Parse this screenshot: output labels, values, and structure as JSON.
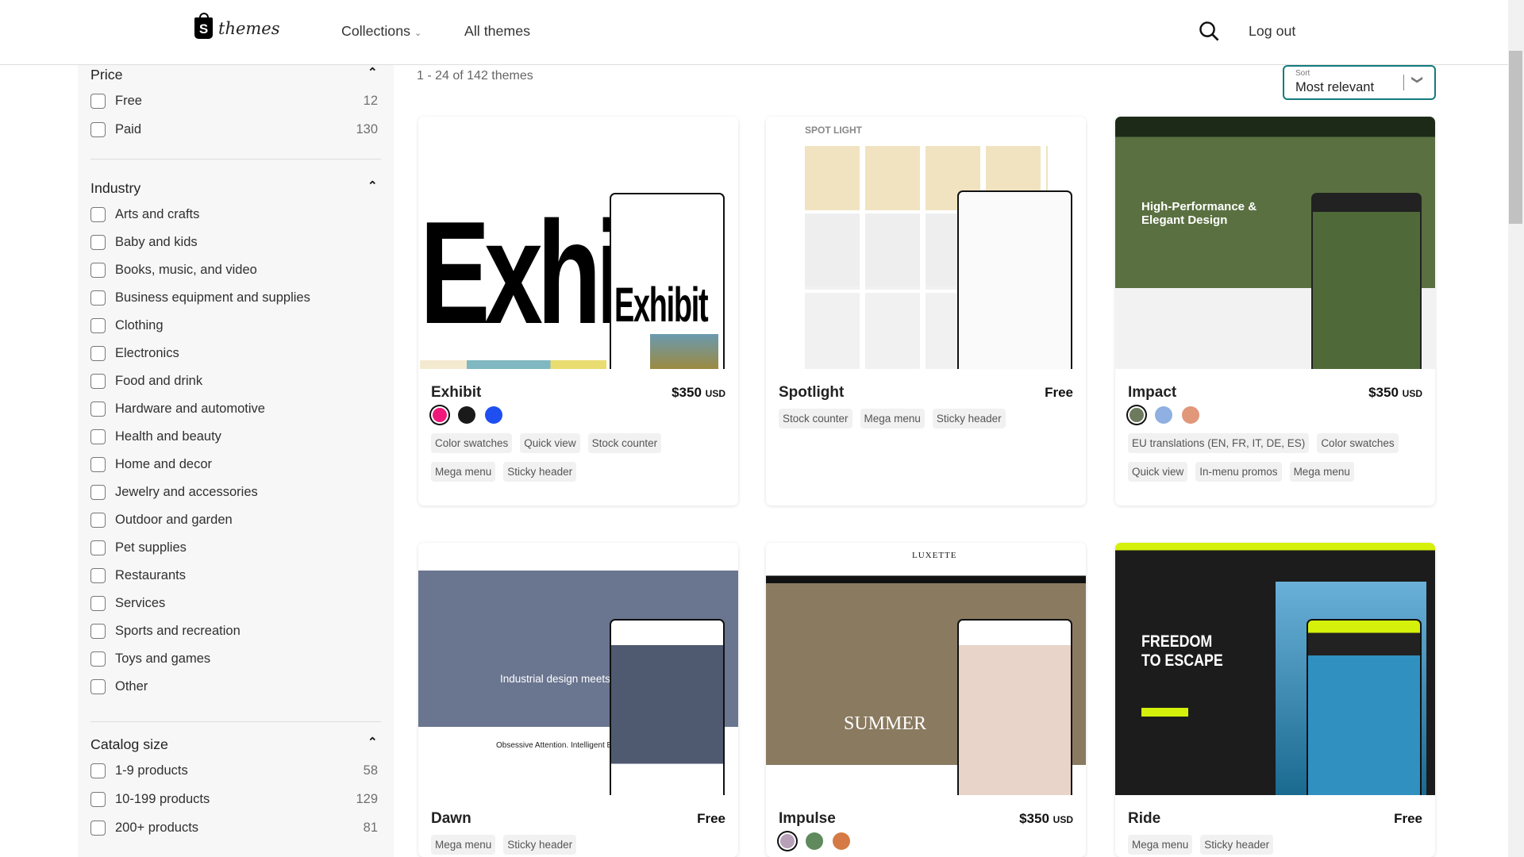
{
  "header": {
    "logo_text": "themes",
    "nav": [
      {
        "label": "Collections"
      },
      {
        "label": "All themes"
      }
    ],
    "logout": "Log out"
  },
  "sidebar": {
    "price": {
      "title": "Price",
      "options": [
        {
          "label": "Free",
          "count": "12"
        },
        {
          "label": "Paid",
          "count": "130"
        }
      ]
    },
    "industry": {
      "title": "Industry",
      "options": [
        "Arts and crafts",
        "Baby and kids",
        "Books, music, and video",
        "Business equipment and supplies",
        "Clothing",
        "Electronics",
        "Food and drink",
        "Hardware and automotive",
        "Health and beauty",
        "Home and decor",
        "Jewelry and accessories",
        "Outdoor and garden",
        "Pet supplies",
        "Restaurants",
        "Services",
        "Sports and recreation",
        "Toys and games",
        "Other"
      ]
    },
    "catalog": {
      "title": "Catalog size",
      "options": [
        {
          "label": "1-9 products",
          "count": "58"
        },
        {
          "label": "10-199 products",
          "count": "129"
        },
        {
          "label": "200+ products",
          "count": "81"
        }
      ]
    }
  },
  "results": {
    "count": "1 - 24 of 142 themes",
    "sort_label": "Sort",
    "sort_value": "Most relevant"
  },
  "themes": [
    {
      "name": "Exhibit",
      "price": "$350",
      "currency": "USD",
      "swatches": [
        "#f0187a",
        "#1a1a1a",
        "#1f4ff0"
      ],
      "tags": [
        "Color swatches",
        "Quick view",
        "Stock counter",
        "Mega menu",
        "Sticky header"
      ],
      "preview": {
        "headline": "Exhi",
        "phone_headline": "Exhibit"
      }
    },
    {
      "name": "Spotlight",
      "price": "Free",
      "currency": "",
      "swatches": [],
      "tags": [
        "Stock counter",
        "Mega menu",
        "Sticky header"
      ],
      "preview": {
        "headline": "SPOT LIGHT"
      }
    },
    {
      "name": "Impact",
      "price": "$350",
      "currency": "USD",
      "swatches": [
        "#6e7a5e",
        "#8fb0e0",
        "#e0977a"
      ],
      "tags": [
        "EU translations (EN, FR, IT, DE, ES)",
        "Color swatches",
        "Quick view",
        "In-menu promos",
        "Mega menu"
      ],
      "preview": {
        "headline": "High-Performance & Elegant Design"
      }
    },
    {
      "name": "Dawn",
      "price": "Free",
      "currency": "",
      "swatches": [],
      "tags": [
        "Mega menu",
        "Sticky header"
      ],
      "preview": {
        "headline": "Industrial design meets fashion.",
        "caption": "Obsessive Attention. Intelligent Effort."
      }
    },
    {
      "name": "Impulse",
      "price": "$350",
      "currency": "USD",
      "swatches": [
        "#b8a0b8",
        "#5e8a5e",
        "#d57a45"
      ],
      "tags": [],
      "preview": {
        "headline": "SUMMER",
        "brand": "LUXETTE"
      }
    },
    {
      "name": "Ride",
      "price": "Free",
      "currency": "",
      "swatches": [],
      "tags": [
        "Mega menu",
        "Sticky header"
      ],
      "preview": {
        "headline": "FREEDOM TO ESCAPE"
      }
    }
  ],
  "colors": {
    "accent": "#147b80",
    "sidebar_bg": "#f7f7f7",
    "tag_bg": "#f1f1f1"
  }
}
